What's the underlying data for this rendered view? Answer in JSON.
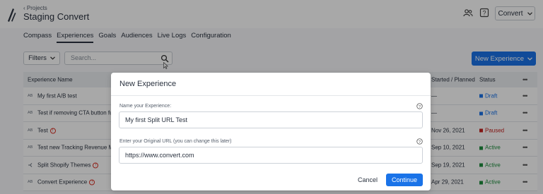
{
  "header": {
    "breadcrumb": "‹ Projects",
    "project_title": "Staging Convert",
    "account_button": "Convert"
  },
  "nav": {
    "tabs": [
      {
        "label": "Compass",
        "active": false
      },
      {
        "label": "Experiences",
        "active": true
      },
      {
        "label": "Goals",
        "active": false
      },
      {
        "label": "Audiences",
        "active": false
      },
      {
        "label": "Live Logs",
        "active": false
      },
      {
        "label": "Configuration",
        "active": false
      }
    ]
  },
  "toolbar": {
    "filters_label": "Filters",
    "search_placeholder": "Search...",
    "new_experience_label": "New Experience"
  },
  "table": {
    "headers": {
      "name": "Experience Name",
      "started": "Started / Planned",
      "status": "Status"
    },
    "rows": [
      {
        "type": "AB",
        "name": "My first A/B test",
        "warning": false,
        "started": "—",
        "status": "Draft",
        "status_color": "#1a73e8"
      },
      {
        "type": "AB",
        "name": "Test if removing CTA button fu",
        "warning": false,
        "started": "—",
        "status": "Draft",
        "status_color": "#1a73e8"
      },
      {
        "type": "AB",
        "name": "Test",
        "warning": true,
        "started": "Nov 26, 2021",
        "status": "Paused",
        "status_color": "#c5221f"
      },
      {
        "type": "AB",
        "name": "Test new Tracking Revenue Me",
        "warning": false,
        "started": "Sep 10, 2021",
        "status": "Active",
        "status_color": "#1e8e3e"
      },
      {
        "type": "SPLIT",
        "name": "Split Shopify Themes",
        "warning": true,
        "started": "Sep 19, 2021",
        "status": "Active",
        "status_color": "#1e8e3e"
      },
      {
        "type": "AB",
        "name": "Convert Experience",
        "warning": true,
        "started": "Apr 29, 2021",
        "status": "Active",
        "status_color": "#1e8e3e"
      }
    ]
  },
  "modal": {
    "title": "New Experience",
    "name_label": "Name your Experience:",
    "name_value": "My first Split URL Test",
    "url_label": "Enter your Original URL (you can change this later)",
    "url_value": "https://www.convert.com",
    "cancel_label": "Cancel",
    "continue_label": "Continue"
  },
  "colors": {
    "primary": "#1a73e8",
    "overlay": "rgba(0,0,0,0.34)"
  },
  "icons": [
    "logo-icon",
    "users-icon",
    "help-icon",
    "chevron-down-icon",
    "search-icon",
    "cursor-icon",
    "warning-icon",
    "kebab-icon"
  ]
}
